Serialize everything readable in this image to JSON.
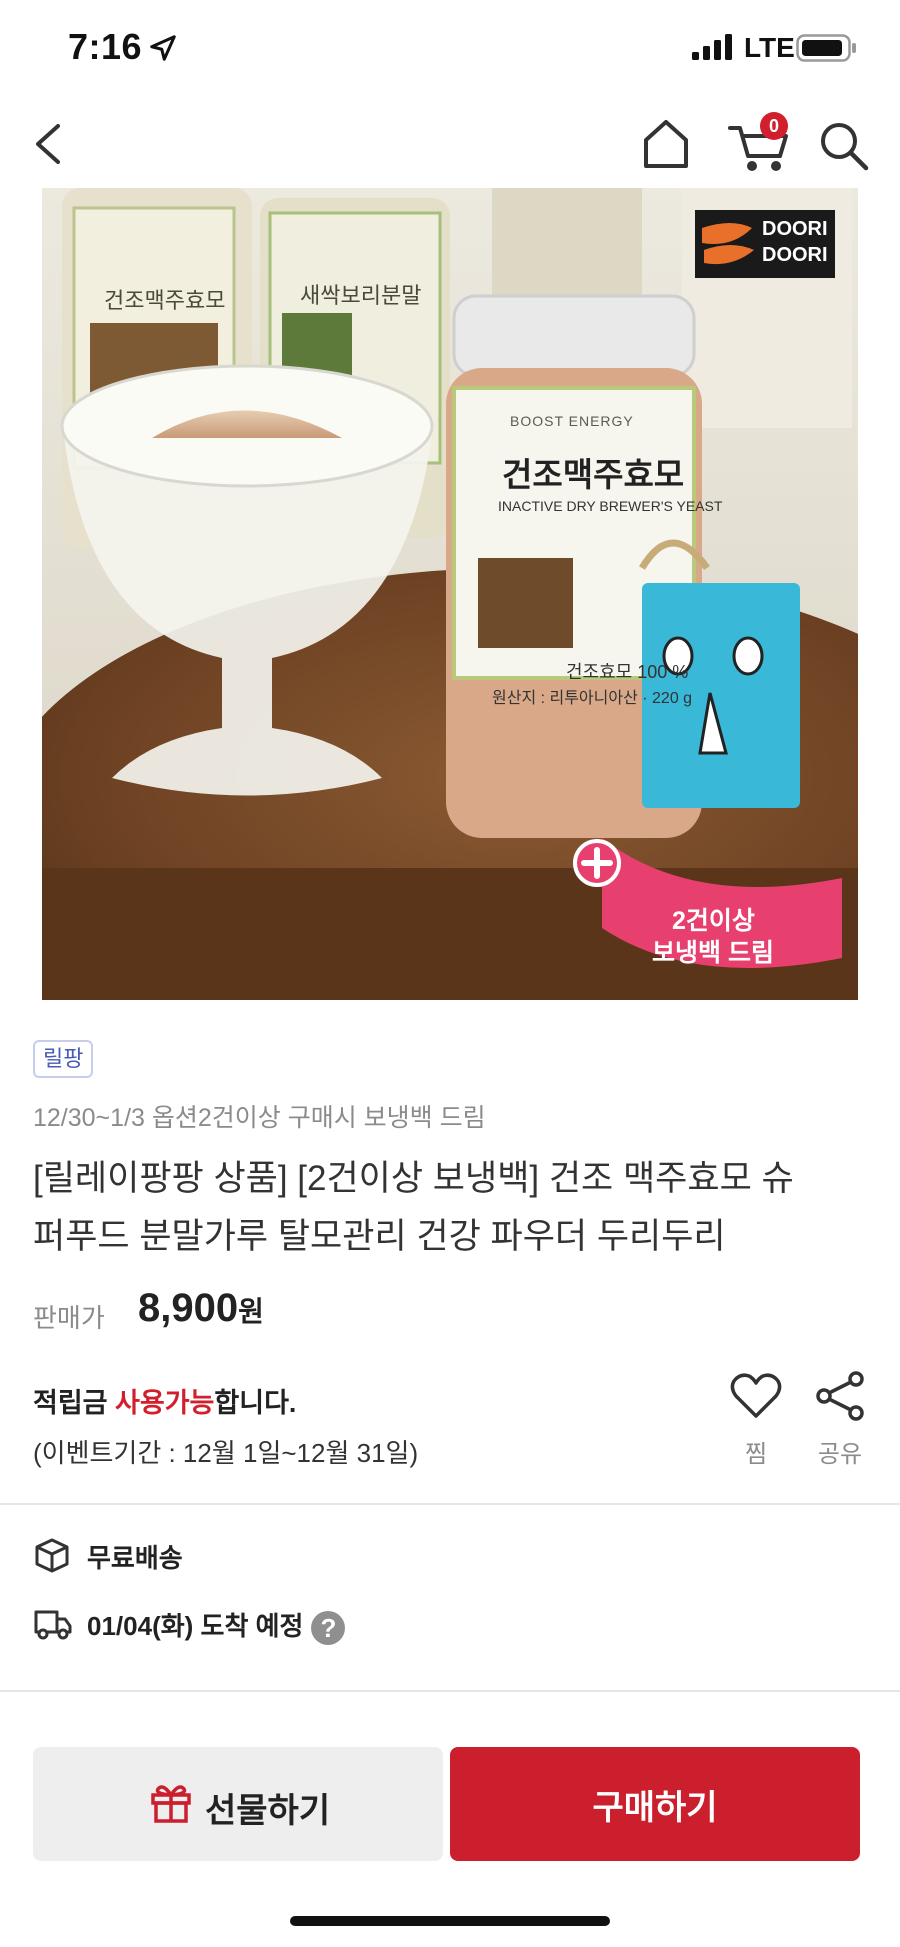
{
  "status_bar": {
    "time": "7:16",
    "network": "LTE"
  },
  "nav": {
    "cart_count": "0"
  },
  "hero": {
    "brand_logo_line1": "DOORI",
    "brand_logo_line2": "DOORI",
    "jar_brand": "BOOST ENERGY",
    "jar_title": "건조맥주효모",
    "jar_subtitle": "INACTIVE DRY BREWER'S YEAST",
    "jar_content": "건조효모 100 %",
    "jar_origin": "원산지 : 리투아니아산 · 220 g",
    "bg_jar_left": "건조맥주효모",
    "bg_jar_right": "새싹보리분말",
    "badge_line1": "2건이상",
    "badge_line2": "보냉백 드림"
  },
  "product": {
    "tag": "릴팡",
    "promo": "12/30~1/3 옵션2건이상 구매시 보냉백 드림",
    "title_line1": "[릴레이팡팡 상품] [2건이상 보냉백] 건조 맥주효모 슈",
    "title_line2": "퍼푸드 분말가루 탈모관리 건강 파우더 두리두리",
    "price_label": "판매가",
    "price": "8,900",
    "currency": "원"
  },
  "points": {
    "prefix": "적립금 ",
    "highlight": "사용가능",
    "suffix": "합니다.",
    "event_period": "(이벤트기간 : 12월 1일~12월 31일)"
  },
  "actions": {
    "like_label": "찜",
    "share_label": "공유"
  },
  "shipping": {
    "free_label": "무료배송",
    "arrival": "01/04(화) 도착 예정",
    "help": "?"
  },
  "buttons": {
    "gift": "선물하기",
    "buy": "구매하기"
  },
  "colors": {
    "accent_red": "#cc1f2e",
    "tag_blue": "#4a5ab5"
  }
}
